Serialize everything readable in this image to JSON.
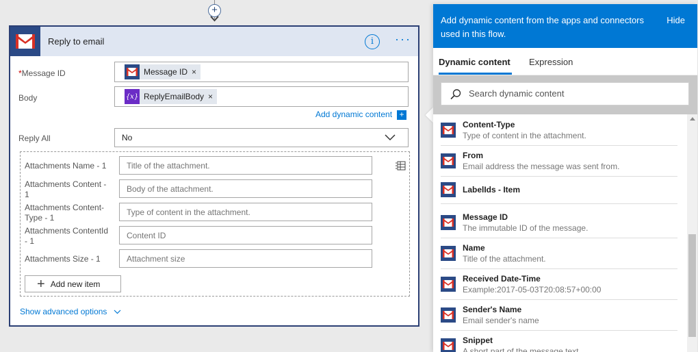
{
  "card": {
    "title": "Reply to email",
    "fields": {
      "message_id": {
        "label": "Message ID",
        "required_mark": "*",
        "token": "Message ID",
        "token_remove": "×"
      },
      "body": {
        "label": "Body",
        "token": "ReplyEmailBody",
        "token_remove": "×",
        "token_icon_glyph": "{x}"
      },
      "add_dynamic": "Add dynamic content",
      "add_dynamic_glyph": "+",
      "reply_all": {
        "label": "Reply All",
        "value": "No"
      }
    },
    "attachments": [
      {
        "label": "Attachments Name - 1",
        "placeholder": "Title of the attachment."
      },
      {
        "label": "Attachments Content - 1",
        "placeholder": "Body of the attachment."
      },
      {
        "label": "Attachments Content-Type - 1",
        "placeholder": "Type of content in the attachment."
      },
      {
        "label": "Attachments ContentId - 1",
        "placeholder": "Content ID"
      },
      {
        "label": "Attachments Size - 1",
        "placeholder": "Attachment size"
      }
    ],
    "add_new_item": "Add new item",
    "add_new_item_glyph": "+",
    "show_advanced": "Show advanced options",
    "info_glyph": "i",
    "more_glyph": "···"
  },
  "connector": {
    "plus_glyph": "+"
  },
  "panel": {
    "header_text": "Add dynamic content from the apps and connectors used in this flow.",
    "hide": "Hide",
    "tabs": [
      {
        "label": "Dynamic content",
        "active": true
      },
      {
        "label": "Expression",
        "active": false
      }
    ],
    "search_placeholder": "Search dynamic content",
    "items": [
      {
        "name": "Content-Type",
        "desc": "Type of content in the attachment."
      },
      {
        "name": "From",
        "desc": "Email address the message was sent from."
      },
      {
        "name": "LabelIds - Item",
        "desc": ""
      },
      {
        "name": "Message ID",
        "desc": "The immutable ID of the message."
      },
      {
        "name": "Name",
        "desc": "Title of the attachment."
      },
      {
        "name": "Received Date-Time",
        "desc": "Example:2017-05-03T20:08:57+00:00"
      },
      {
        "name": "Sender's Name",
        "desc": "Email sender's name"
      },
      {
        "name": "Snippet",
        "desc": "A short part of the message text."
      }
    ]
  },
  "colors": {
    "brand_navy": "#2b4a86",
    "accent_blue": "#0078d4",
    "expression_purple": "#6b2cc6",
    "gmail_red": "#d93025"
  },
  "icons": {
    "gmail": "gmail-icon",
    "expression": "expression-icon",
    "info": "info-icon",
    "more": "more-icon",
    "search": "search-icon",
    "table": "table-icon",
    "chevron": "chevron-down-icon"
  }
}
